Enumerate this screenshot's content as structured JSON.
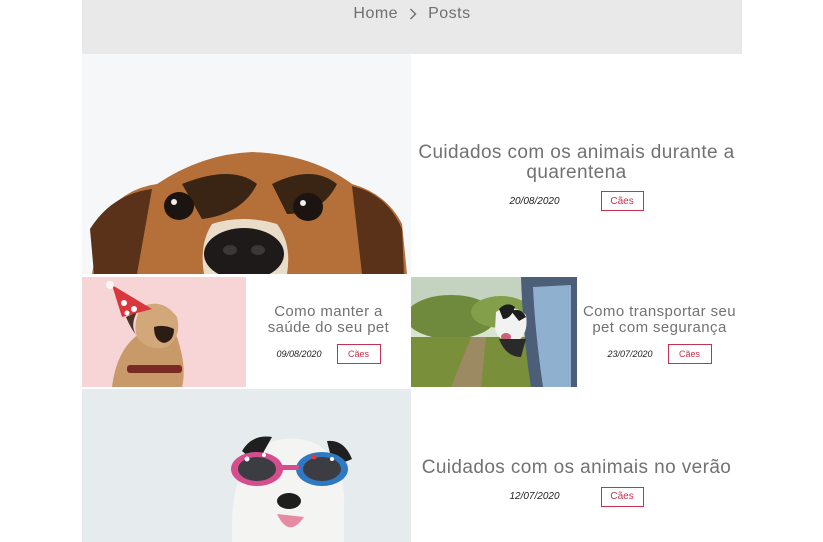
{
  "breadcrumb": {
    "home": "Home",
    "current": "Posts"
  },
  "posts": [
    {
      "title": "Cuidados com os animais durante a quarentena",
      "date": "20/08/2020",
      "category": "Cães",
      "image": "dog-peeking-photo"
    },
    {
      "title": "Como manter a saúde do seu pet",
      "date": "09/08/2020",
      "category": "Cães",
      "image": "pug-party-hat-photo"
    },
    {
      "title": "Como transportar seu pet com segurança",
      "date": "23/07/2020",
      "category": "Cães",
      "image": "dog-car-window-photo"
    },
    {
      "title": "Cuidados com os animais no verão",
      "date": "12/07/2020",
      "category": "Cães",
      "image": "dog-sunglasses-photo"
    }
  ],
  "colors": {
    "header_bg": "#e9e9e9",
    "title": "#727272",
    "tag_accent": "#c4324f"
  }
}
